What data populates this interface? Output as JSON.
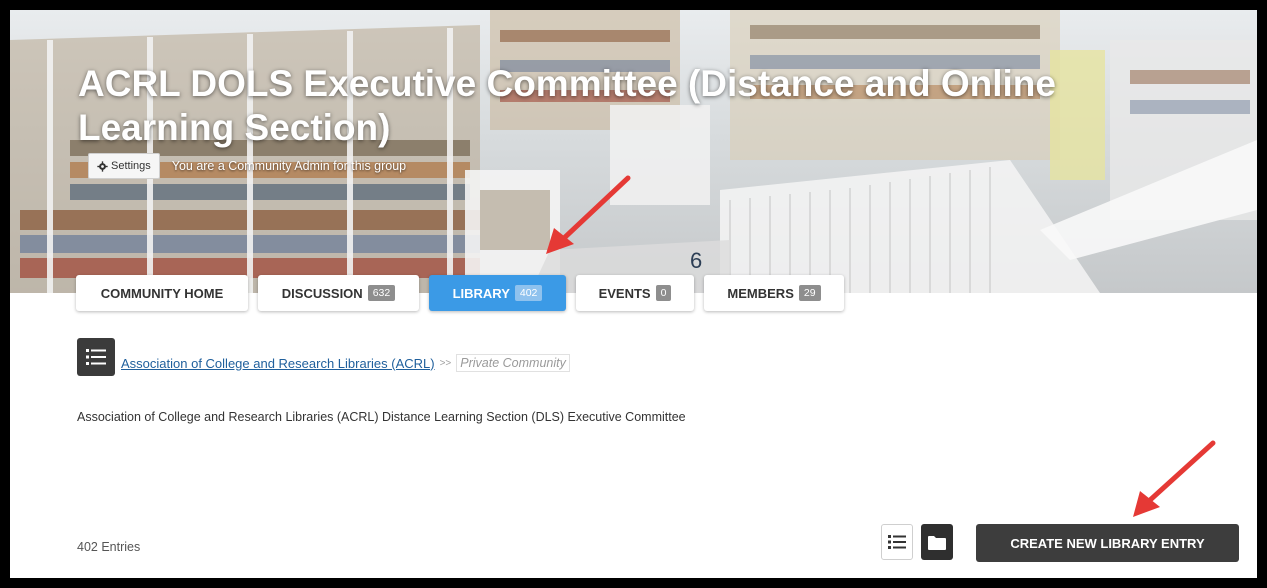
{
  "hero": {
    "title_line1": "ACRL DOLS Executive Committee (Distance and Online",
    "title_line2": "Learning Section)",
    "settings_label": "Settings",
    "admin_note": "You are a Community Admin for this group",
    "floor_number": "6"
  },
  "tabs": [
    {
      "label": "COMMUNITY HOME",
      "count": null,
      "active": false
    },
    {
      "label": "DISCUSSION",
      "count": "632",
      "active": false
    },
    {
      "label": "LIBRARY",
      "count": "402",
      "active": true
    },
    {
      "label": "EVENTS",
      "count": "0",
      "active": false
    },
    {
      "label": "MEMBERS",
      "count": "29",
      "active": false
    }
  ],
  "breadcrumb": {
    "parent": "Association of College and Research Libraries (ACRL)",
    "separator": ">>",
    "current": "Private Community"
  },
  "description": "Association of College and Research Libraries (ACRL) Distance Learning Section (DLS) Executive Committee",
  "library": {
    "entries_label": "402 Entries",
    "create_button_label": "CREATE NEW LIBRARY ENTRY"
  },
  "colors": {
    "accent_tab": "#3b9ae6",
    "dark_button": "#3d3d3d",
    "annotation_arrow": "#e53935",
    "link": "#1f5f9c"
  },
  "icons": {
    "settings": "gear-icon",
    "list_toggle": "list-icon",
    "list_view": "list-view-icon",
    "folder_view": "folder-icon",
    "annotation": "arrow-annotation"
  }
}
